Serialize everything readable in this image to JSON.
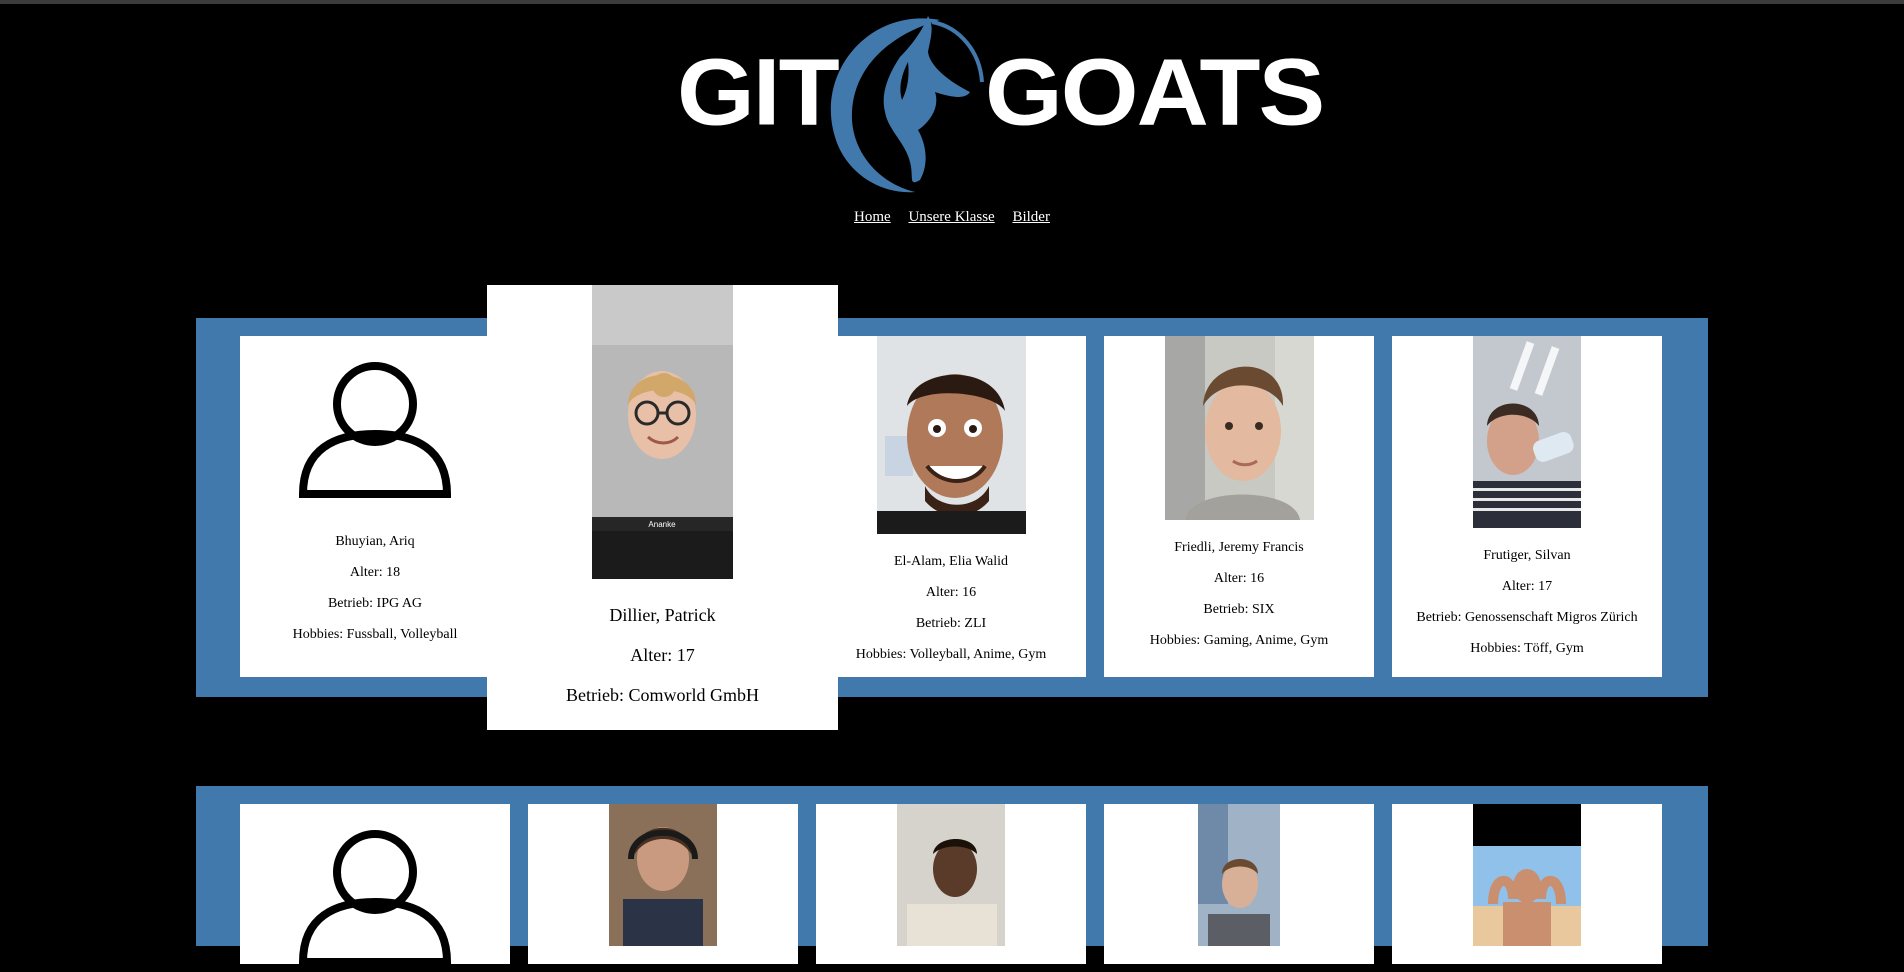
{
  "header": {
    "logo_left": "GIT",
    "logo_right": "GOATS",
    "logo_icon": "goat-head-icon",
    "brand_color": "#4279ad"
  },
  "nav": {
    "items": [
      {
        "label": "Home"
      },
      {
        "label": "Unsere Klasse"
      },
      {
        "label": "Bilder"
      }
    ]
  },
  "row1": {
    "cards": [
      {
        "name": "Bhuyian, Ariq",
        "alter": "Alter: 18",
        "betrieb": "Betrieb: IPG AG",
        "hobbies": "Hobbies: Fussball, Volleyball",
        "image": "user-placeholder-icon"
      },
      {
        "name": "Dillier, Patrick",
        "alter": "Alter: 17",
        "betrieb": "Betrieb: Comworld GmbH",
        "image": "person-photo",
        "photo_caption": "Ananke"
      },
      {
        "name": "El-Alam, Elia Walid",
        "alter": "Alter: 16",
        "betrieb": "Betrieb: ZLI",
        "hobbies": "Hobbies: Volleyball, Anime, Gym",
        "image": "person-photo"
      },
      {
        "name": "Friedli, Jeremy Francis",
        "alter": "Alter: 16",
        "betrieb": "Betrieb: SIX",
        "hobbies": "Hobbies: Gaming, Anime, Gym",
        "image": "person-photo"
      },
      {
        "name": "Frutiger, Silvan",
        "alter": "Alter: 17",
        "betrieb": "Betrieb: Genossenschaft Migros Zürich",
        "hobbies": "Hobbies: Töff, Gym",
        "image": "person-photo"
      }
    ]
  },
  "row2": {
    "cards": [
      {
        "image": "user-placeholder-icon"
      },
      {
        "image": "person-photo"
      },
      {
        "image": "person-photo"
      },
      {
        "image": "person-photo"
      },
      {
        "image": "person-photo"
      }
    ]
  }
}
